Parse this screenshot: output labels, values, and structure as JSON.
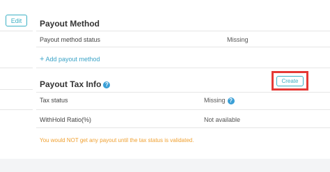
{
  "sidebar": {
    "edit_label": "Edit"
  },
  "payout_method": {
    "title": "Payout Method",
    "status_label": "Payout method status",
    "status_value": "Missing",
    "add_link_plus": "+",
    "add_link_label": "Add payout method"
  },
  "payout_tax": {
    "title": "Payout Tax Info",
    "help_glyph": "?",
    "create_label": "Create",
    "tax_status_label": "Tax status",
    "tax_status_value": "Missing",
    "withhold_label": "WithHold Ratio(%)",
    "withhold_value": "Not available",
    "warning": "You would NOT get any payout until the tax status is validated."
  }
}
